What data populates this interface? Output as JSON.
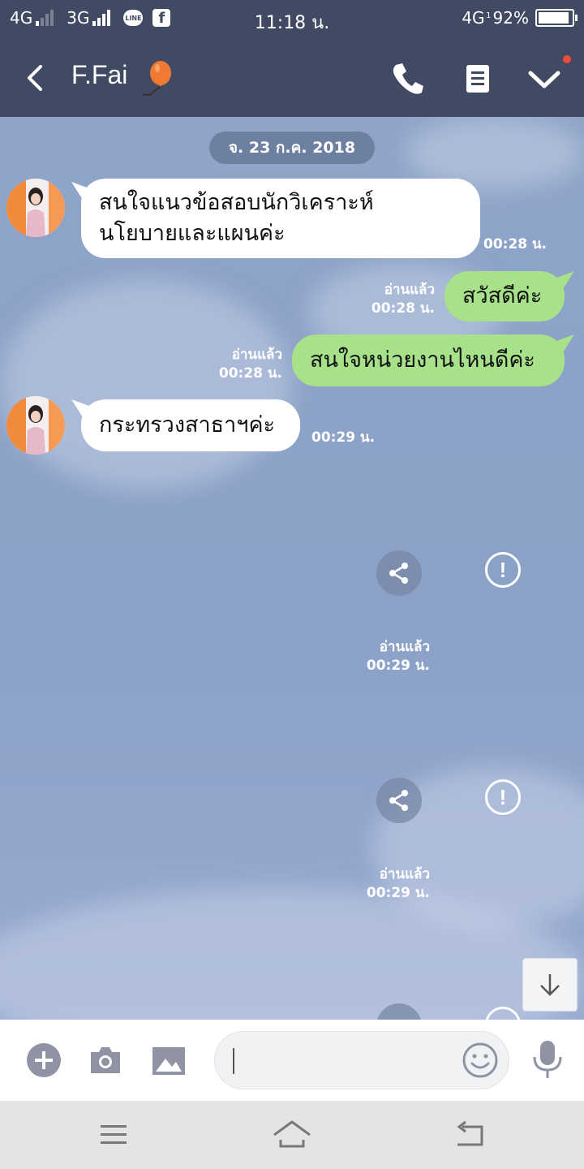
{
  "status_bar": {
    "net1": "4G",
    "net2": "3G",
    "time": "11:18 น.",
    "net3": "4G",
    "net3_sub": "1",
    "battery_label": "92%",
    "battery_level": 0.92,
    "line_badge": "LINE",
    "fb_badge": "f"
  },
  "header": {
    "title": "F.Fai",
    "icons": [
      "back-icon",
      "balloon-icon",
      "phone-icon",
      "memo-icon",
      "chevron-down-icon"
    ],
    "accent": "#f04a3a"
  },
  "chat": {
    "date": "จ. 23 ก.ค. 2018",
    "messages": [
      {
        "side": "in",
        "line1": "สนใจแนวข้อสอบนักวิเคราะห์",
        "line2": "นโยบายและแผนค่ะ",
        "time": "00:28 น."
      },
      {
        "side": "out",
        "text": "สวัสดีค่ะ",
        "read": "อ่านแล้ว",
        "time": "00:28 น."
      },
      {
        "side": "out",
        "text": "สนใจหน่วยงานไหนดีค่ะ",
        "read": "อ่านแล้ว",
        "time": "00:28 น."
      },
      {
        "side": "in",
        "text": "กระทรวงสาธาฯค่ะ",
        "time": "00:29 น."
      }
    ],
    "media1": {
      "read": "อ่านแล้ว",
      "time": "00:29 น."
    },
    "media2": {
      "read": "อ่านแล้ว",
      "time": "00:29 น."
    },
    "alert_glyph": "!"
  },
  "colors": {
    "header_bg": "#414a63",
    "outgoing_bubble": "#a7e18a",
    "incoming_bubble": "#ffffff",
    "chat_bg": "#8ea3c8"
  },
  "input_bar": {
    "icons": [
      "plus-icon",
      "camera-icon",
      "image-icon",
      "emoji-icon",
      "microphone-icon"
    ],
    "value": "",
    "placeholder": ""
  },
  "nav_bar": {
    "icons": [
      "menu-icon",
      "home-icon",
      "back-nav-icon"
    ]
  }
}
